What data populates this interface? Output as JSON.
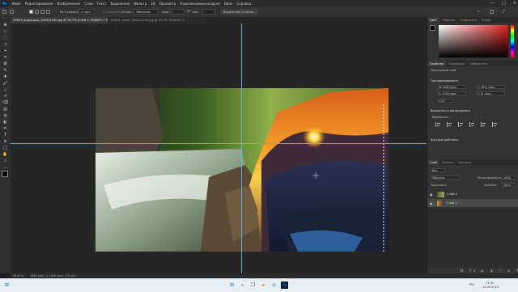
{
  "menu": {
    "app_icon": "Ps",
    "items": [
      "Файл",
      "Редактирование",
      "Изображение",
      "Слои",
      "Текст",
      "Выделение",
      "Фильтр",
      "3D",
      "Просмотр",
      "Подключаемые модули",
      "Окно",
      "Справка"
    ],
    "window_controls": [
      "—",
      "□",
      "✕"
    ]
  },
  "options": {
    "feather_label": "Растушевка:",
    "feather_value": "0 пикс.",
    "smooth_label": "Сглаживание",
    "style_label": "Стиль:",
    "style_value": "Обычный",
    "width_label": "Шир.:",
    "height_label": "Выс.:",
    "select_mask_button": "Выделение и маска..."
  },
  "tabs": [
    {
      "label": "X5628_водопады_3840x2160.jpg @ 26,7% (Слой 1, RGB/8*) *  ✕",
      "active": true
    },
    {
      "label": "X5634_закат_3840x2160.jpg @ 33,3% (RGB/8*)  ✕",
      "active": false
    }
  ],
  "tools": [
    "move",
    "artboard",
    "marquee",
    "lasso",
    "object-select",
    "crop",
    "frame",
    "eyedropper",
    "heal",
    "brush",
    "stamp",
    "history-brush",
    "eraser",
    "gradient",
    "blur",
    "dodge",
    "pen",
    "type",
    "path-select",
    "rectangle",
    "hand",
    "zoom",
    "more"
  ],
  "panels": {
    "color_tabs": [
      "Цвет",
      "Образцы",
      "Градиенты",
      "Узоры"
    ],
    "props_tabs": [
      "Свойства",
      "Коррекция",
      "Библиотеки"
    ],
    "props_layer_type": "Пиксельный слой",
    "transform_label": "Трансформировать",
    "transform_fields": [
      "W: 3840 пикс.",
      "X: 3951 пикс.",
      "H: 2160 пикс.",
      "Y: 21 пикс.",
      "0,00°"
    ],
    "align_label": "Выровнять и распределить",
    "align_sub": "Выровнять:",
    "quick_actions_label": "Быстрые действия",
    "layers_tabs": [
      "Слои",
      "Каналы",
      "Контуры"
    ],
    "layers_filter": "Вид",
    "blend_mode": "Обычные",
    "opacity_label": "Непрозрачность:",
    "opacity_value": "100%",
    "lock_label": "Закрепить:",
    "fill_label": "Заливка:",
    "fill_value": "100%",
    "layers": [
      {
        "name": "Слой 0",
        "selected": false
      },
      {
        "name": "Слой 1",
        "selected": true
      }
    ]
  },
  "status": {
    "zoom": "26,67%",
    "doc_size": "3840 пикс. x 2160 пикс. (72 ppi)"
  },
  "taskbar": {
    "lang": "РУС",
    "time": "11:39",
    "date": "11.09.2023"
  },
  "colors": {
    "accent_blue": "#31a8ff",
    "guide": "#4fb3e8",
    "selected_layer": "#4a4a4a"
  }
}
